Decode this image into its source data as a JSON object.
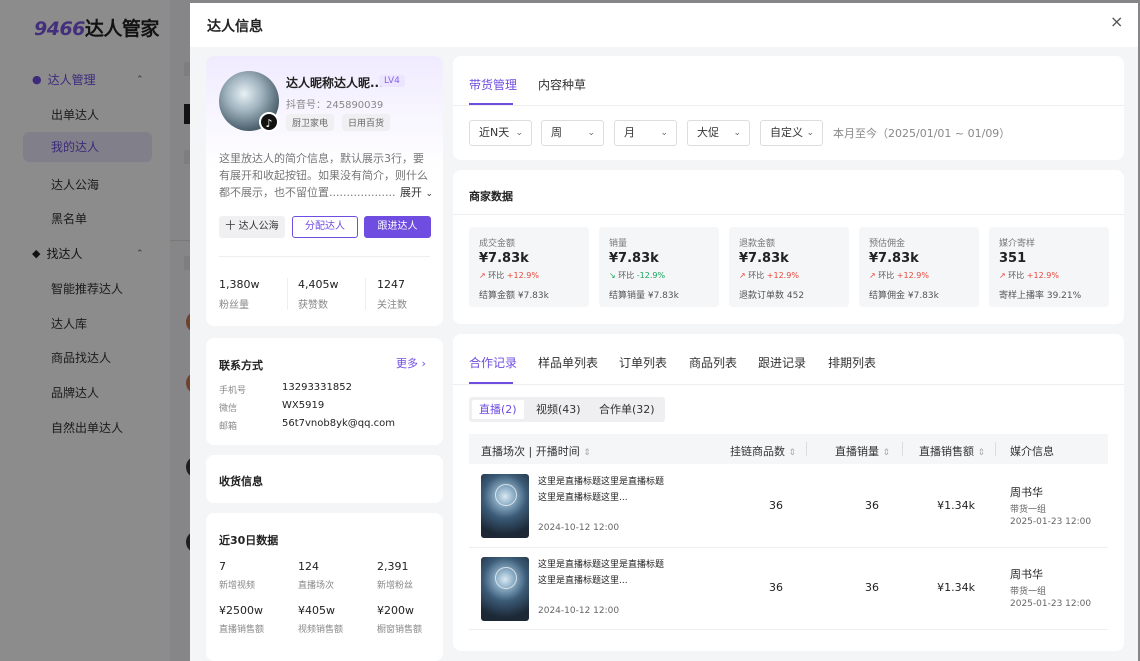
{
  "app": {
    "logo_num": "9466",
    "logo_text": "达人管家"
  },
  "sidebar": {
    "group1": {
      "icon": "person-icon",
      "label": "达人管理"
    },
    "group1_items": [
      {
        "label": "出单达人"
      },
      {
        "label": "我的达人"
      },
      {
        "label": "达人公海"
      },
      {
        "label": "黑名单"
      }
    ],
    "group2": {
      "icon": "handshake-icon",
      "label": "找达人"
    },
    "group2_items": [
      {
        "label": "智能推荐达人"
      },
      {
        "label": "达人库"
      },
      {
        "label": "商品找达人"
      },
      {
        "label": "品牌达人"
      },
      {
        "label": "自然出单达人"
      }
    ]
  },
  "drawer": {
    "title": "达人信息",
    "close_glyph": "×"
  },
  "profile": {
    "name": "达人昵称达人昵...",
    "level": "LV4",
    "douyin_id": "抖音号：245890039",
    "tags": [
      "厨卫家电",
      "日用百货"
    ],
    "bio": "这里放达人的简介信息，默认展示3行，要有展开和收起按钮。如果没有简介，则什么都不展示，也不留位置......................",
    "expand_label": "展开",
    "btn_sea": "十 达人公海",
    "btn_assign": "分配达人",
    "btn_follow": "跟进达人",
    "stats": [
      {
        "value": "1,380w",
        "label": "粉丝量"
      },
      {
        "value": "4,405w",
        "label": "获赞数"
      },
      {
        "value": "1247",
        "label": "关注数"
      }
    ]
  },
  "contact": {
    "title": "联系方式",
    "more": "更多",
    "phone_label": "手机号",
    "phone": "13293331852",
    "wechat_label": "微信",
    "wechat": "WX5919",
    "email_label": "邮箱",
    "email": "56t7vnob8yk@qq.com"
  },
  "shipping": {
    "title": "收货信息"
  },
  "last30": {
    "title": "近30日数据",
    "items": [
      {
        "value": "7",
        "label": "新增视频"
      },
      {
        "value": "124",
        "label": "直播场次"
      },
      {
        "value": "2,391",
        "label": "新增粉丝"
      },
      {
        "value": "¥2500w",
        "label": "直播销售额"
      },
      {
        "value": "¥405w",
        "label": "视频销售额"
      },
      {
        "value": "¥200w",
        "label": "橱窗销售额"
      }
    ]
  },
  "main_tabs": [
    {
      "label": "带货管理"
    },
    {
      "label": "内容种草"
    }
  ],
  "filters": [
    {
      "label": "近N天"
    },
    {
      "label": "周"
    },
    {
      "label": "月"
    },
    {
      "label": "大促"
    },
    {
      "label": "自定义"
    }
  ],
  "date_range": "本月至今（2025/01/01 ~ 01/09）",
  "merchant": {
    "title": "商家数据",
    "metrics": [
      {
        "label": "成交金额",
        "value": "¥7.83k",
        "cmp_label": "环比",
        "cmp": "+12.9%",
        "dir": "up",
        "sub": "结算金额 ¥7.83k"
      },
      {
        "label": "销量",
        "value": "¥7.83k",
        "cmp_label": "环比",
        "cmp": "-12.9%",
        "dir": "down",
        "sub": "结算销量 ¥7.83k"
      },
      {
        "label": "退款金额",
        "value": "¥7.83k",
        "cmp_label": "环比",
        "cmp": "+12.9%",
        "dir": "up",
        "sub": "退款订单数 452"
      },
      {
        "label": "预估佣金",
        "value": "¥7.83k",
        "cmp_label": "环比",
        "cmp": "+12.9%",
        "dir": "up",
        "sub": "结算佣金 ¥7.83k"
      },
      {
        "label": "媒介寄样",
        "value": "351",
        "cmp_label": "环比",
        "cmp": "+12.9%",
        "dir": "up",
        "sub": "寄样上播率 39.21%"
      }
    ]
  },
  "records_tabs": [
    {
      "label": "合作记录"
    },
    {
      "label": "样品单列表"
    },
    {
      "label": "订单列表"
    },
    {
      "label": "商品列表"
    },
    {
      "label": "跟进记录"
    },
    {
      "label": "排期列表"
    }
  ],
  "sub_tabs": [
    {
      "label": "直播(2)"
    },
    {
      "label": "视频(43)"
    },
    {
      "label": "合作单(32)"
    }
  ],
  "table": {
    "headers": [
      "直播场次 | 开播时间",
      "挂链商品数",
      "直播销量",
      "直播销售额",
      "媒介信息"
    ],
    "sort_glyph": "⇕",
    "rows": [
      {
        "title": "这里是直播标题这里是直播标题这里是直播标题这里...",
        "time": "2024-10-12 12:00",
        "links": "36",
        "sales": "36",
        "revenue": "¥1.34k",
        "host": "周书华",
        "group": "带货一组",
        "date": "2025-01-23 12:00"
      },
      {
        "title": "这里是直播标题这里是直播标题这里是直播标题这里...",
        "time": "2024-10-12 12:00",
        "links": "36",
        "sales": "36",
        "revenue": "¥1.34k",
        "host": "周书华",
        "group": "带货一组",
        "date": "2025-01-23 12:00"
      }
    ]
  }
}
